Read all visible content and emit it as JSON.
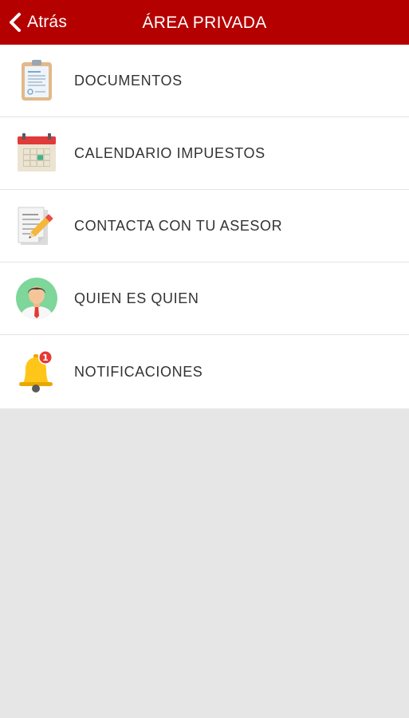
{
  "header": {
    "back_label": "Atrás",
    "title": "ÁREA PRIVADA",
    "background_color": "#b50000"
  },
  "menu": {
    "items": [
      {
        "label": "DOCUMENTOS",
        "icon": "clipboard-icon"
      },
      {
        "label": "CALENDARIO IMPUESTOS",
        "icon": "calendar-icon"
      },
      {
        "label": "CONTACTA CON TU ASESOR",
        "icon": "document-pencil-icon"
      },
      {
        "label": "QUIEN ES QUIEN",
        "icon": "person-avatar-icon"
      },
      {
        "label": "NOTIFICACIONES",
        "icon": "bell-icon",
        "badge": "1"
      }
    ]
  }
}
